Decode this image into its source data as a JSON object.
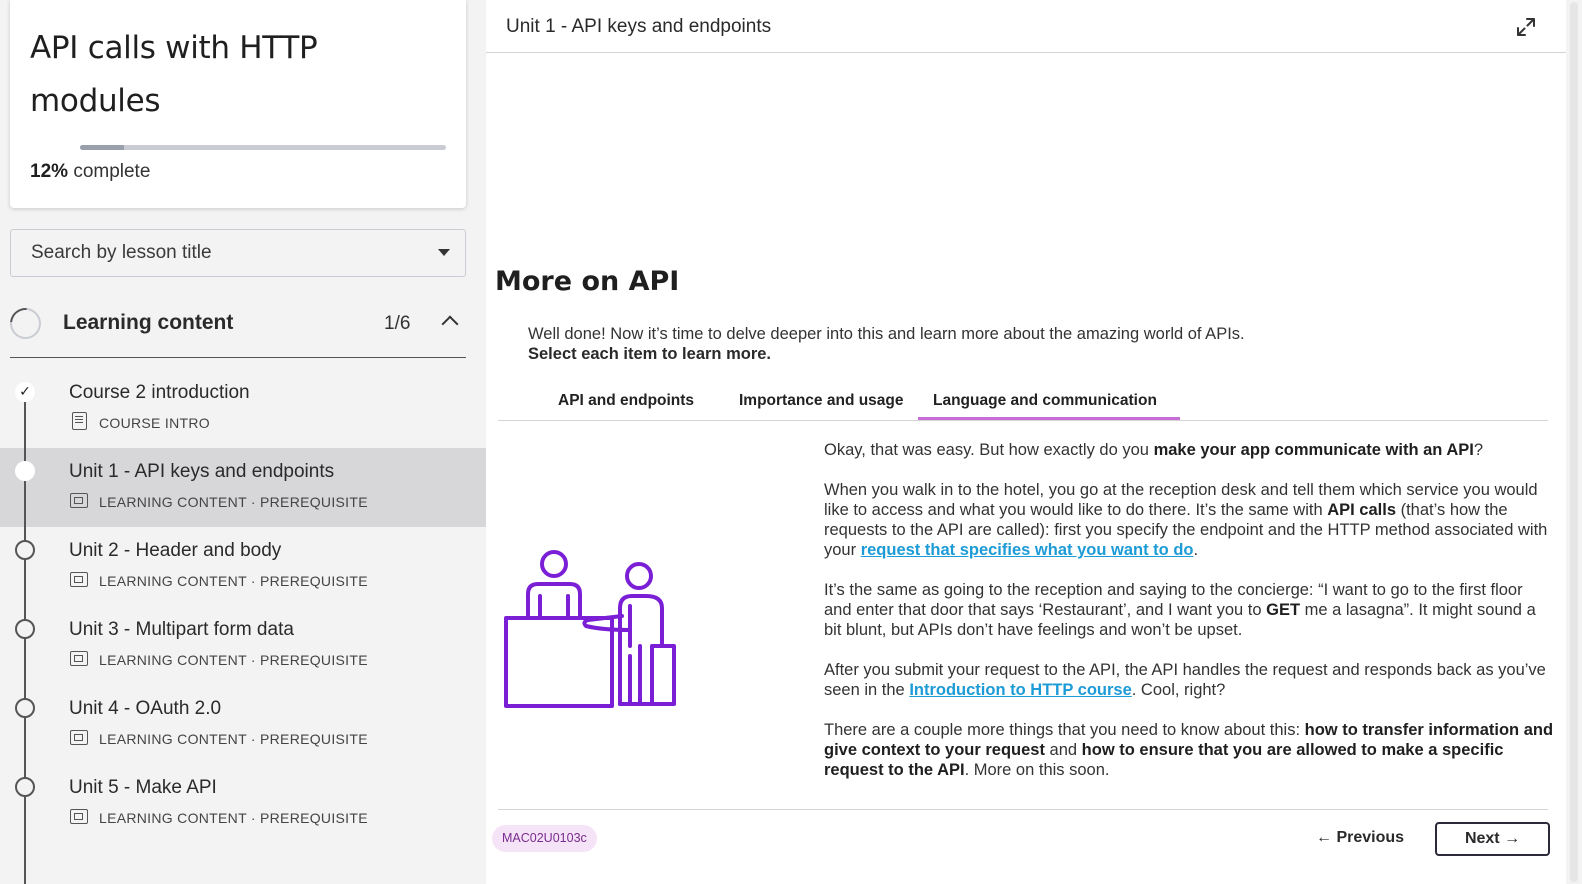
{
  "course": {
    "title": "API calls with HTTP modules",
    "progress_value": "12%",
    "progress_suffix": "complete",
    "progress_fraction": 0.12
  },
  "search": {
    "placeholder": "Search by lesson title"
  },
  "section": {
    "title": "Learning content",
    "count": "1/6"
  },
  "lessons": [
    {
      "title": "Course 2 introduction",
      "meta": "COURSE INTRO",
      "state": "completed",
      "icon": "document-icon"
    },
    {
      "title": "Unit 1 - API keys and endpoints",
      "meta": "LEARNING CONTENT · PREREQUISITE",
      "state": "current",
      "icon": "slides-icon"
    },
    {
      "title": "Unit 2 - Header and body",
      "meta": "LEARNING CONTENT · PREREQUISITE",
      "state": "not-started",
      "icon": "slides-icon"
    },
    {
      "title": "Unit 3 - Multipart form data",
      "meta": "LEARNING CONTENT · PREREQUISITE",
      "state": "not-started",
      "icon": "slides-icon"
    },
    {
      "title": "Unit 4 - OAuth 2.0",
      "meta": "LEARNING CONTENT · PREREQUISITE",
      "state": "not-started",
      "icon": "slides-icon"
    },
    {
      "title": "Unit 5 - Make API",
      "meta": "LEARNING CONTENT · PREREQUISITE",
      "state": "not-started",
      "icon": "slides-icon"
    }
  ],
  "main": {
    "header_title": "Unit 1 - API keys and endpoints",
    "heading": "More on API",
    "intro_line1": "Well done! Now it’s time to delve deeper into this and learn more about the amazing world of APIs.",
    "intro_line2": "Select each item to learn more.",
    "tabs": [
      {
        "label": "API and endpoints"
      },
      {
        "label": "Importance and usage"
      },
      {
        "label": "Language and communication",
        "selected": true
      }
    ],
    "paragraphs": {
      "p1_a": "Okay, that was easy. But how exactly do you ",
      "p1_b": "make your app communicate with an API",
      "p1_c": "?",
      "p2_a": "When you walk in to the hotel, you go at the reception desk and tell them which service you would like to access and what you would like to do there. It’s the same with ",
      "p2_b": "API calls",
      "p2_c": " (that’s how the requests to the API are called): first you specify the endpoint and the HTTP method associated with your ",
      "p2_link": "request that specifies what you want to do",
      "p2_d": ".",
      "p3_a": "It’s the same as going to the reception and saying to the concierge: “I want to go to the first floor and enter that door that says ‘Restaurant’, and I want you to ",
      "p3_b": "GET",
      "p3_c": " me a lasagna”. It might sound a bit blunt, but APIs don’t have feelings and won’t be upset.",
      "p4_a": "After you submit your request to the API, the API handles the request and responds back as you’ve seen in the ",
      "p4_link": "Introduction to HTTP course",
      "p4_b": ". Cool, right?",
      "p5_a": "There are a couple more things that you need to know about this: ",
      "p5_b": "how to transfer information and give context to your request",
      "p5_c": " and ",
      "p5_d": "how to ensure that you are allowed to make a specific request to the API",
      "p5_e": ". More on this soon."
    },
    "code_badge": "MAC02U0103c",
    "prev_label": "← Previous",
    "next_label": "Next →"
  },
  "colors": {
    "accent_purple": "#7a1fd6",
    "tab_underline": "#c86dd7",
    "link_blue": "#1c9bd6",
    "badge_bg": "#f5e3f7"
  }
}
